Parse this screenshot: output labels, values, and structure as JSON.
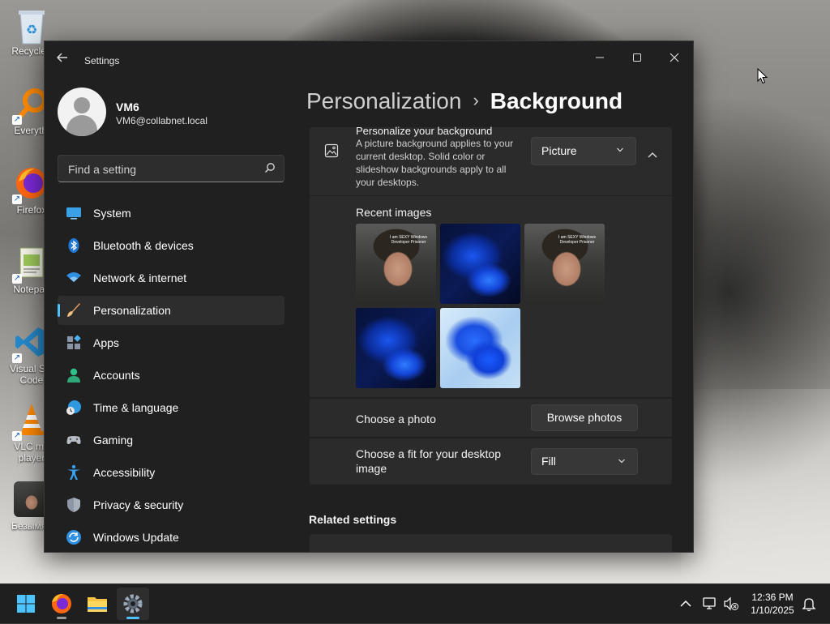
{
  "desktop": {
    "icons": [
      {
        "label": "Recycle Bin",
        "display": "Recycle I"
      },
      {
        "label": "Everything",
        "display": "Everythi"
      },
      {
        "label": "Firefox",
        "display": "Firefox"
      },
      {
        "label": "Notepad",
        "display": "Notepad"
      },
      {
        "label": "Visual Studio Code",
        "display_line1": "Visual Stu",
        "display_line2": "Code"
      },
      {
        "label": "VLC media player",
        "display_line1": "VLC me",
        "display_line2": "player"
      },
      {
        "label": "Безымянный",
        "display": "Безымян"
      }
    ]
  },
  "window": {
    "title": "Settings",
    "controls": {
      "minimize": "—",
      "maximize": "☐",
      "close": "✕"
    }
  },
  "profile": {
    "name": "VM6",
    "email": "VM6@collabnet.local"
  },
  "search": {
    "placeholder": "Find a setting"
  },
  "nav": {
    "items": [
      {
        "label": "System",
        "icon": "monitor-icon"
      },
      {
        "label": "Bluetooth & devices",
        "icon": "bluetooth-icon"
      },
      {
        "label": "Network & internet",
        "icon": "wifi-icon"
      },
      {
        "label": "Personalization",
        "icon": "brush-icon",
        "active": true
      },
      {
        "label": "Apps",
        "icon": "apps-icon"
      },
      {
        "label": "Accounts",
        "icon": "person-icon"
      },
      {
        "label": "Time & language",
        "icon": "globe-clock-icon"
      },
      {
        "label": "Gaming",
        "icon": "gamepad-icon"
      },
      {
        "label": "Accessibility",
        "icon": "accessibility-icon"
      },
      {
        "label": "Privacy & security",
        "icon": "shield-icon"
      },
      {
        "label": "Windows Update",
        "icon": "update-icon"
      }
    ]
  },
  "breadcrumb": {
    "parent": "Personalization",
    "separator": "›",
    "current": "Background"
  },
  "background_card": {
    "title": "Personalize your background",
    "description": "A picture background applies to your current desktop. Solid color or slideshow backgrounds apply to all your desktops.",
    "type_value": "Picture"
  },
  "recent_images": {
    "title": "Recent images",
    "face_caption": "I am SEXY Windows Developer Prisoner"
  },
  "choose_photo": {
    "label": "Choose a photo",
    "button": "Browse photos"
  },
  "fit": {
    "label": "Choose a fit for your desktop image",
    "value": "Fill"
  },
  "related": {
    "title": "Related settings"
  },
  "taskbar": {
    "apps": [
      "start-icon",
      "firefox-icon",
      "file-explorer-icon",
      "settings-icon"
    ],
    "clock": {
      "time": "12:36 PM",
      "date": "1/10/2025"
    }
  },
  "colors": {
    "accent": "#4cc2ff",
    "window_bg": "#202020",
    "card_bg": "#2b2b2b"
  }
}
